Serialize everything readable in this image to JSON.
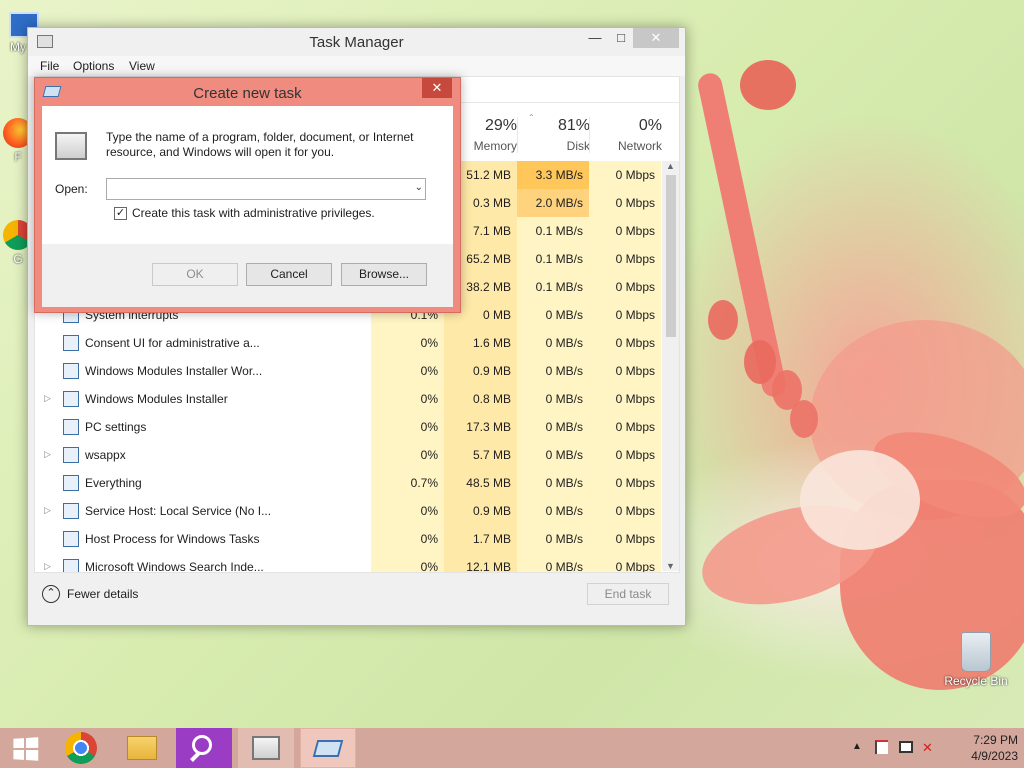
{
  "desktop": {
    "icons": [
      {
        "label": "My C",
        "icon": "computer-icon"
      },
      {
        "label": "F",
        "icon": "firefox-icon"
      },
      {
        "label": "G",
        "icon": "chrome-icon"
      },
      {
        "label": "Recycle Bin",
        "icon": "recycle-bin-icon"
      }
    ]
  },
  "task_manager": {
    "title": "Task Manager",
    "menu": [
      "File",
      "Options",
      "View"
    ],
    "columns": [
      {
        "pct": "29%",
        "name": "Memory"
      },
      {
        "pct": "81%",
        "name": "Disk"
      },
      {
        "pct": "0%",
        "name": "Network"
      }
    ],
    "rows": [
      {
        "name": "",
        "cpu": "",
        "mem": "51.2 MB",
        "disk": "3.3 MB/s",
        "net": "0 Mbps",
        "expand": false
      },
      {
        "name": "",
        "cpu": "",
        "mem": "0.3 MB",
        "disk": "2.0 MB/s",
        "net": "0 Mbps",
        "expand": false
      },
      {
        "name": "",
        "cpu": "",
        "mem": "7.1 MB",
        "disk": "0.1 MB/s",
        "net": "0 Mbps",
        "expand": false
      },
      {
        "name": "",
        "cpu": "",
        "mem": "65.2 MB",
        "disk": "0.1 MB/s",
        "net": "0 Mbps",
        "expand": false
      },
      {
        "name": "",
        "cpu": "",
        "mem": "38.2 MB",
        "disk": "0.1 MB/s",
        "net": "0 Mbps",
        "expand": false
      },
      {
        "name": "System interrupts",
        "cpu": "0.1%",
        "mem": "0 MB",
        "disk": "0 MB/s",
        "net": "0 Mbps",
        "expand": false
      },
      {
        "name": "Consent UI for administrative a...",
        "cpu": "0%",
        "mem": "1.6 MB",
        "disk": "0 MB/s",
        "net": "0 Mbps",
        "expand": false
      },
      {
        "name": "Windows Modules Installer Wor...",
        "cpu": "0%",
        "mem": "0.9 MB",
        "disk": "0 MB/s",
        "net": "0 Mbps",
        "expand": false
      },
      {
        "name": "Windows Modules Installer",
        "cpu": "0%",
        "mem": "0.8 MB",
        "disk": "0 MB/s",
        "net": "0 Mbps",
        "expand": true
      },
      {
        "name": "PC settings",
        "cpu": "0%",
        "mem": "17.3 MB",
        "disk": "0 MB/s",
        "net": "0 Mbps",
        "expand": false
      },
      {
        "name": "wsappx",
        "cpu": "0%",
        "mem": "5.7 MB",
        "disk": "0 MB/s",
        "net": "0 Mbps",
        "expand": true
      },
      {
        "name": "Everything",
        "cpu": "0.7%",
        "mem": "48.5 MB",
        "disk": "0 MB/s",
        "net": "0 Mbps",
        "expand": false
      },
      {
        "name": "Service Host: Local Service (No I...",
        "cpu": "0%",
        "mem": "0.9 MB",
        "disk": "0 MB/s",
        "net": "0 Mbps",
        "expand": true
      },
      {
        "name": "Host Process for Windows Tasks",
        "cpu": "0%",
        "mem": "1.7 MB",
        "disk": "0 MB/s",
        "net": "0 Mbps",
        "expand": false
      },
      {
        "name": "Microsoft Windows Search Inde...",
        "cpu": "0%",
        "mem": "12.1 MB",
        "disk": "0 MB/s",
        "net": "0 Mbps",
        "expand": true
      }
    ],
    "fewer_details": "Fewer details",
    "end_task": "End task"
  },
  "dialog": {
    "title": "Create new task",
    "description": "Type the name of a program, folder, document, or Internet resource, and Windows will open it for you.",
    "open_label": "Open:",
    "open_value": "",
    "admin_label": "Create this task with administrative privileges.",
    "admin_checked": true,
    "ok": "OK",
    "cancel": "Cancel",
    "browse": "Browse..."
  },
  "taskbar": {
    "items": [
      "start-icon",
      "chrome-icon",
      "file-explorer-icon",
      "search-everything-icon",
      "task-manager-icon",
      "run-dialog-icon"
    ],
    "time": "7:29 PM",
    "date": "4/9/2023"
  }
}
